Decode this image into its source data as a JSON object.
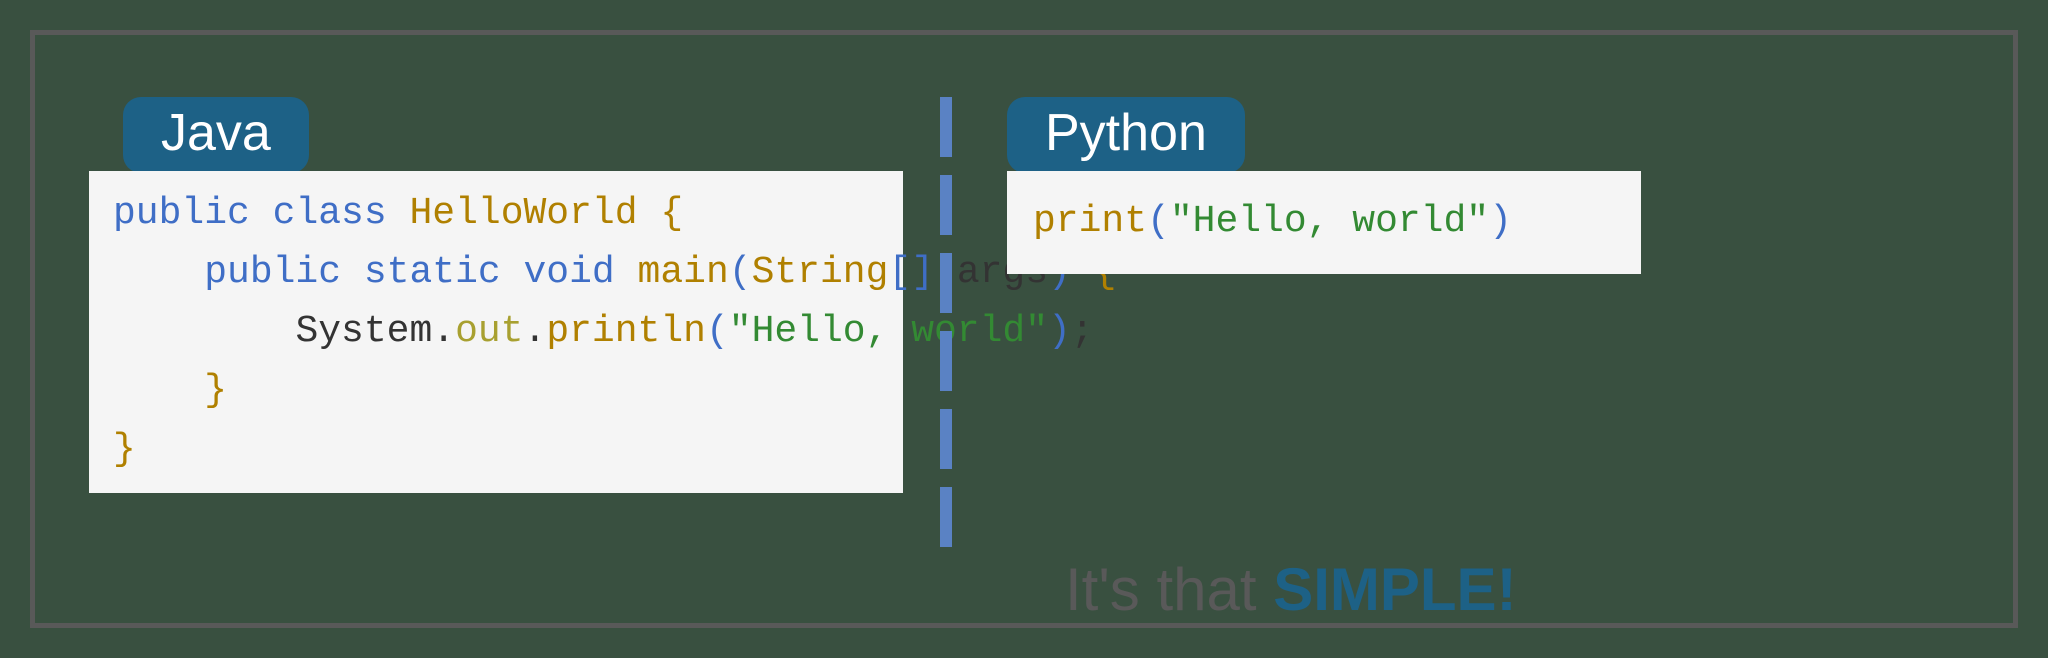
{
  "labels": {
    "java": "Java",
    "python": "Python"
  },
  "java_tokens": {
    "t01": "public",
    "t02": "class",
    "t03": "HelloWorld",
    "t04": "{",
    "t05": "public",
    "t06": "static",
    "t07": "void",
    "t08": "main",
    "t09": "(",
    "t10": "String",
    "t11": "[",
    "t12": "]",
    "t13": "args",
    "t14": ")",
    "t15": "{",
    "t16": "System",
    "t17": ".",
    "t18": "out",
    "t19": ".",
    "t20": "println",
    "t21": "(",
    "t22": "\"Hello, world\"",
    "t23": ")",
    "t24": ";",
    "t25": "}",
    "t26": "}"
  },
  "python_tokens": {
    "p01": "print",
    "p02": "(",
    "p03": "\"Hello, world\"",
    "p04": ")"
  },
  "tagline": {
    "prefix": "It's that ",
    "emph": "SIMPLE",
    "excl": "!"
  }
}
